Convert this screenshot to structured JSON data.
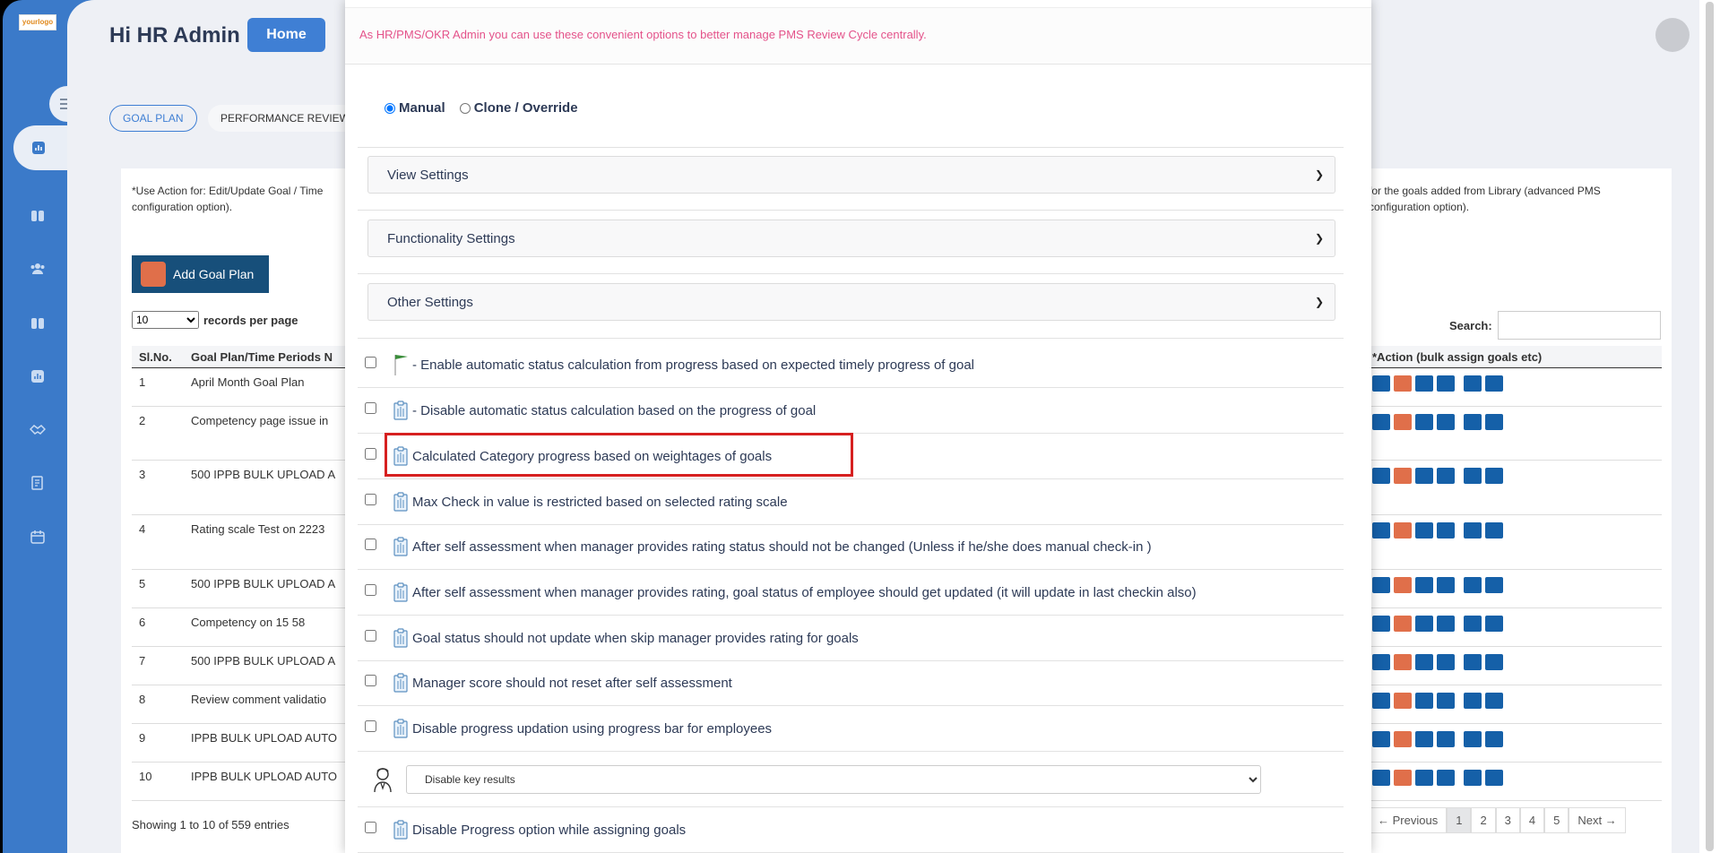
{
  "app": {
    "logo_text": "yourlogo",
    "greeting": "Hi HR Admin",
    "home_label": "Home",
    "tabs": [
      "GOAL PLAN",
      "PERFORMANCE REVIEW CY"
    ],
    "note_left": "*Use Action for: Edit/Update Goal / Time configuration option).",
    "note_right": "for the goals added from Library (advanced PMS configuration option).",
    "add_goal_plan_label": "Add Goal Plan",
    "records_per_page_value": "10",
    "records_per_page_label": "records per page",
    "search_label": "Search:",
    "table": {
      "col_slno": "Sl.No.",
      "col_goal_plan": "Goal Plan/Time Periods N",
      "col_action": "*Action (bulk assign goals etc)",
      "rows": [
        {
          "no": "1",
          "name": "April Month Goal Plan"
        },
        {
          "no": "2",
          "name": "Competency page issue in"
        },
        {
          "no": "3",
          "name": "500 IPPB BULK UPLOAD A"
        },
        {
          "no": "4",
          "name": "Rating scale Test on 2223"
        },
        {
          "no": "5",
          "name": "500 IPPB BULK UPLOAD A"
        },
        {
          "no": "6",
          "name": "Competency on 15 58"
        },
        {
          "no": "7",
          "name": "500 IPPB BULK UPLOAD A"
        },
        {
          "no": "8",
          "name": "Review comment validatio"
        },
        {
          "no": "9",
          "name": "IPPB BULK UPLOAD AUTO"
        },
        {
          "no": "10",
          "name": "IPPB BULK UPLOAD AUTO"
        }
      ]
    },
    "showing_text": "Showing 1 to 10 of 559 entries",
    "pager": [
      "← Previous",
      "1",
      "2",
      "3",
      "4",
      "5",
      "Next →"
    ]
  },
  "modal": {
    "notice": "As HR/PMS/OKR Admin you can use these convenient options to better manage PMS Review Cycle centrally.",
    "mode_manual": "Manual",
    "mode_clone": "Clone / Override",
    "sections": [
      "View Settings",
      "Functionality Settings",
      "Other Settings"
    ],
    "options": [
      "- Enable automatic status calculation from progress based on expected timely progress of goal",
      "- Disable automatic status calculation based on the progress of goal",
      "Calculated Category progress based on weightages of goals",
      "Max Check in value is restricted based on selected rating scale",
      "After self assessment when manager provides rating status should not be changed (Unless if he/she does manual check-in )",
      "After self assessment when manager provides rating, goal status of employee should get updated (it will update in last checkin also)",
      "Goal status should not update when skip manager provides rating for goals",
      "Manager score should not reset after self assessment",
      "Disable progress updation using progress bar for employees"
    ],
    "key_results_select": "Disable key results",
    "last_option": "Disable Progress option while assigning goals"
  },
  "colors": {
    "sidebar_blue": "#3b7ac9",
    "notice_pink": "#e4528a",
    "highlight_red": "#d62020",
    "action_blue": "#1560a8",
    "action_red": "#e06f4a"
  }
}
